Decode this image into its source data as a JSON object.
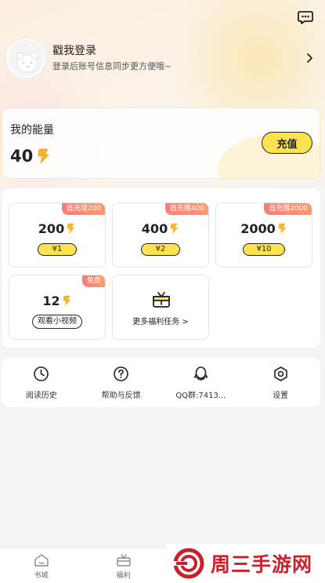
{
  "header": {
    "chat_icon": "chat-bubble-icon"
  },
  "login": {
    "title": "戳我登录",
    "subtitle": "登录后账号信息同步更方便哦~"
  },
  "energy": {
    "title": "我的能量",
    "value": "40",
    "recharge_label": "充值"
  },
  "recharge_options": [
    {
      "badge": "首充增200",
      "amount": "200",
      "price": "¥1"
    },
    {
      "badge": "首充赠400",
      "amount": "400",
      "price": "¥2"
    },
    {
      "badge": "首充赠2000",
      "amount": "2000",
      "price": "¥10"
    }
  ],
  "video_task": {
    "badge": "免费",
    "amount": "12",
    "action_label": "观看小视频"
  },
  "more_tasks": {
    "label": "更多福利任务 >"
  },
  "tools": [
    {
      "label": "阅读历史",
      "icon": "history-clock-icon"
    },
    {
      "label": "帮助与反馈",
      "icon": "help-question-icon"
    },
    {
      "label": "QQ群:7413...",
      "icon": "qq-penguin-icon"
    },
    {
      "label": "设置",
      "icon": "settings-hex-icon"
    }
  ],
  "bottom_nav": [
    {
      "label": "书城",
      "icon": "home-icon"
    },
    {
      "label": "福利",
      "icon": "gift-box-icon"
    }
  ],
  "watermark": {
    "text": "周三手游网"
  },
  "colors": {
    "accent_yellow": "#fde24f",
    "badge_red": "#ff7a7a",
    "watermark_red": "#c8212b",
    "bolt_orange": "#f7b52c"
  }
}
